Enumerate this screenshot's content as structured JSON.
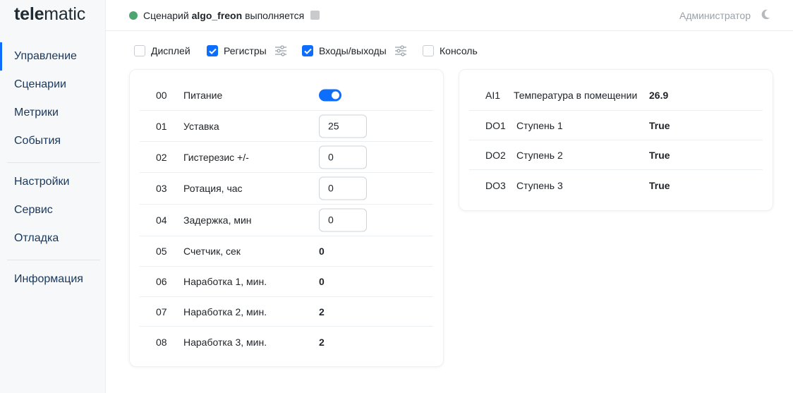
{
  "logo": {
    "part1": "tele",
    "part2": "matic"
  },
  "sidebar": {
    "group1": [
      {
        "label": "Управление"
      },
      {
        "label": "Сценарии"
      },
      {
        "label": "Метрики"
      },
      {
        "label": "События"
      }
    ],
    "group2": [
      {
        "label": "Настройки"
      },
      {
        "label": "Сервис"
      },
      {
        "label": "Отладка"
      }
    ],
    "group3": [
      {
        "label": "Информация"
      }
    ],
    "active": "Управление"
  },
  "header": {
    "status_prefix": "Сценарий",
    "scenario_name": "algo_freon",
    "status_suffix": "выполняется",
    "status_color": "#4ca56f",
    "user": "Администратор",
    "theme_icon": "moon-icon"
  },
  "filters": [
    {
      "label": "Дисплей",
      "checked": false
    },
    {
      "label": "Регистры",
      "checked": true,
      "settings_icon": "sliders-icon"
    },
    {
      "label": "Входы/выходы",
      "checked": true,
      "settings_icon": "sliders-icon"
    },
    {
      "label": "Консоль",
      "checked": false
    }
  ],
  "registers": [
    {
      "num": "00",
      "label": "Питание",
      "type": "toggle",
      "on": true
    },
    {
      "num": "01",
      "label": "Уставка",
      "type": "input",
      "value": "25"
    },
    {
      "num": "02",
      "label": "Гистерезис +/-",
      "type": "input",
      "value": "0"
    },
    {
      "num": "03",
      "label": "Ротация, час",
      "type": "input",
      "value": "0"
    },
    {
      "num": "04",
      "label": "Задержка, мин",
      "type": "input",
      "value": "0"
    },
    {
      "num": "05",
      "label": "Счетчик, сек",
      "type": "value",
      "value": "0"
    },
    {
      "num": "06",
      "label": "Наработка 1, мин.",
      "type": "value",
      "value": "0"
    },
    {
      "num": "07",
      "label": "Наработка 2, мин.",
      "type": "value",
      "value": "2"
    },
    {
      "num": "08",
      "label": "Наработка 3, мин.",
      "type": "value",
      "value": "2"
    }
  ],
  "io": [
    {
      "code": "AI1",
      "label": "Температура в помещении",
      "value": "26.9"
    },
    {
      "code": "DO1",
      "label": "Ступень 1",
      "value": "True"
    },
    {
      "code": "DO2",
      "label": "Ступень 2",
      "value": "True"
    },
    {
      "code": "DO3",
      "label": "Ступень 3",
      "value": "True"
    }
  ],
  "colors": {
    "accent": "#0d6efd",
    "nav_text": "#17375e",
    "status_ok": "#4ca56f"
  }
}
